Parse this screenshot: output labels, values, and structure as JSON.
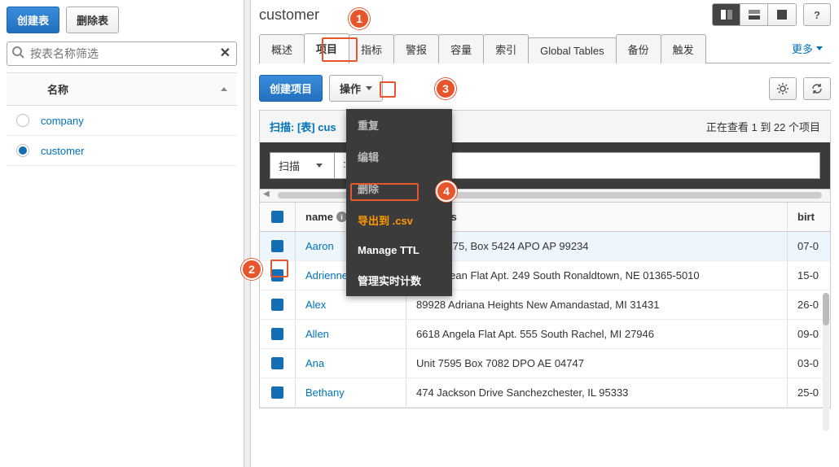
{
  "sidebar": {
    "create_btn": "创建表",
    "delete_btn": "删除表",
    "search_placeholder": "按表名称筛选",
    "name_header": "名称",
    "tables": [
      {
        "name": "company",
        "selected": false
      },
      {
        "name": "customer",
        "selected": true
      }
    ]
  },
  "header": {
    "title": "customer"
  },
  "tabs": {
    "items": [
      "概述",
      "项目",
      "指标",
      "警报",
      "容量",
      "索引",
      "Global Tables",
      "备份",
      "触发"
    ],
    "active": 1,
    "more": "更多"
  },
  "toolbar": {
    "create_item": "创建项目",
    "actions": "操作"
  },
  "dropdown": {
    "items": [
      "重复",
      "编辑",
      "删除",
      "导出到 .csv",
      "Manage TTL",
      "管理实时计数"
    ],
    "highlight": 3
  },
  "scan": {
    "label_left": "扫描: [表] cus",
    "label_right": "正在查看 1 到 22 个项目",
    "scan_select": "扫描",
    "name_field": ": name"
  },
  "columns": {
    "name": "name",
    "address": "address",
    "birth": "birt"
  },
  "rows": [
    {
      "name": "Aaron",
      "address": "PSC 6275, Box 5424 APO AP 99234",
      "birth": "07-0"
    },
    {
      "name": "Adrienne",
      "address": "0649 Sean Flat Apt. 249 South Ronaldtown, NE 01365-5010",
      "birth": "15-0"
    },
    {
      "name": "Alex",
      "address": "89928 Adriana Heights New Amandastad, MI 31431",
      "birth": "26-0"
    },
    {
      "name": "Allen",
      "address": "6618 Angela Flat Apt. 555 South Rachel, MI 27946",
      "birth": "09-0"
    },
    {
      "name": "Ana",
      "address": "Unit 7595 Box 7082 DPO AE 04747",
      "birth": "03-0"
    },
    {
      "name": "Bethany",
      "address": "474 Jackson Drive Sanchezchester, IL 95333",
      "birth": "25-0"
    }
  ],
  "badges": [
    "1",
    "2",
    "3",
    "4"
  ]
}
